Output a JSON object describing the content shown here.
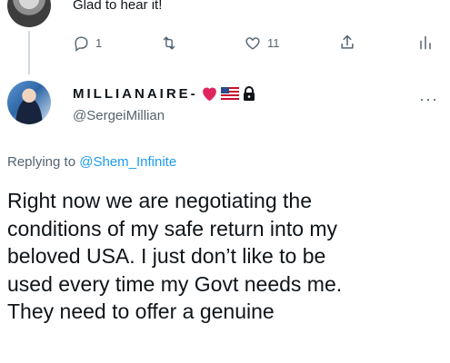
{
  "parent": {
    "text": "Glad to hear it!",
    "replies": "1",
    "likes": "11"
  },
  "tweet": {
    "display_name": "MILLIANAIRE-",
    "handle": "@SergeiMillian",
    "more": "···",
    "replying_prefix": "Replying to ",
    "replying_to": "@Shem_Infinite",
    "lines": [
      "Right now we are negotiating the",
      "conditions of my safe return into my",
      "beloved USA. I just don’t like to be",
      "used every time my Govt needs me.",
      "They need to offer a genuine"
    ]
  },
  "icons": {
    "reply": "reply-icon",
    "retweet": "retweet-icon",
    "like": "heart-outline-icon",
    "share": "share-icon",
    "analytics": "analytics-icon",
    "heart_emoji": "red-heart-icon",
    "flag": "usa-flag-icon",
    "lock": "lock-icon"
  },
  "colors": {
    "text": "#0f1419",
    "secondary": "#536471",
    "link": "#1d9bf0",
    "heart": "#e0245e"
  }
}
